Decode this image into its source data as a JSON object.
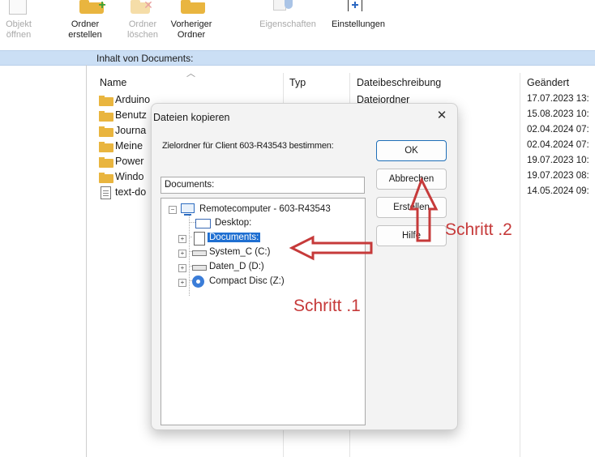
{
  "toolbar": {
    "buttons": [
      {
        "line1": "Objekt",
        "line2": "öffnen"
      },
      {
        "line1": "Ordner",
        "line2": "erstellen"
      },
      {
        "line1": "Ordner",
        "line2": "löschen"
      },
      {
        "line1": "Vorheriger",
        "line2": "Ordner"
      },
      {
        "line1": "Eigenschaften",
        "line2": ""
      },
      {
        "line1": "Einstellungen",
        "line2": ""
      }
    ]
  },
  "pathbar": {
    "text": "Inhalt von Documents:"
  },
  "list": {
    "columns": {
      "name": "Name",
      "type": "Typ",
      "description": "Dateibeschreibung",
      "modified": "Geändert"
    },
    "rows": [
      {
        "name": "Arduino",
        "description": "Dateiordner",
        "modified": "17.07.2023 13:",
        "kind": "folder"
      },
      {
        "name": "Benutz",
        "description": "",
        "modified": "15.08.2023 10:",
        "kind": "folder"
      },
      {
        "name": "Journa",
        "description": "",
        "modified": "02.04.2024 07:",
        "kind": "folder"
      },
      {
        "name": "Meine",
        "description": "",
        "modified": "02.04.2024 07:",
        "kind": "folder"
      },
      {
        "name": "Power",
        "description": "",
        "modified": "19.07.2023 10:",
        "kind": "folder"
      },
      {
        "name": "Windo",
        "description": "",
        "modified": "19.07.2023 08:",
        "kind": "folder"
      },
      {
        "name": "text-do",
        "description": "",
        "modified": "14.05.2024 09:",
        "kind": "file"
      }
    ]
  },
  "dialog": {
    "title": "Dateien kopieren",
    "close_glyph": "✕",
    "prompt": "Zielordner für Client 603-R43543 bestimmen:",
    "combo_value": "Documents:",
    "combo_arrow": "⌵",
    "buttons": {
      "ok": "OK",
      "cancel": "Abbrechen",
      "create": "Erstellen",
      "help": "Hilfe"
    },
    "tree": {
      "root": "Remotecomputer - 603-R43543",
      "children": [
        "Desktop:",
        "Documents:",
        "System_C (C:)",
        "Daten_D (D:)",
        "Compact Disc (Z:)"
      ]
    }
  },
  "annotations": {
    "step1": "Schritt .1",
    "step2": "Schritt .2",
    "color": "#c63a3a"
  },
  "colors": {
    "selection": "#1f6fd1",
    "pathbar": "#cbdff5",
    "folder": "#e9b53f"
  }
}
